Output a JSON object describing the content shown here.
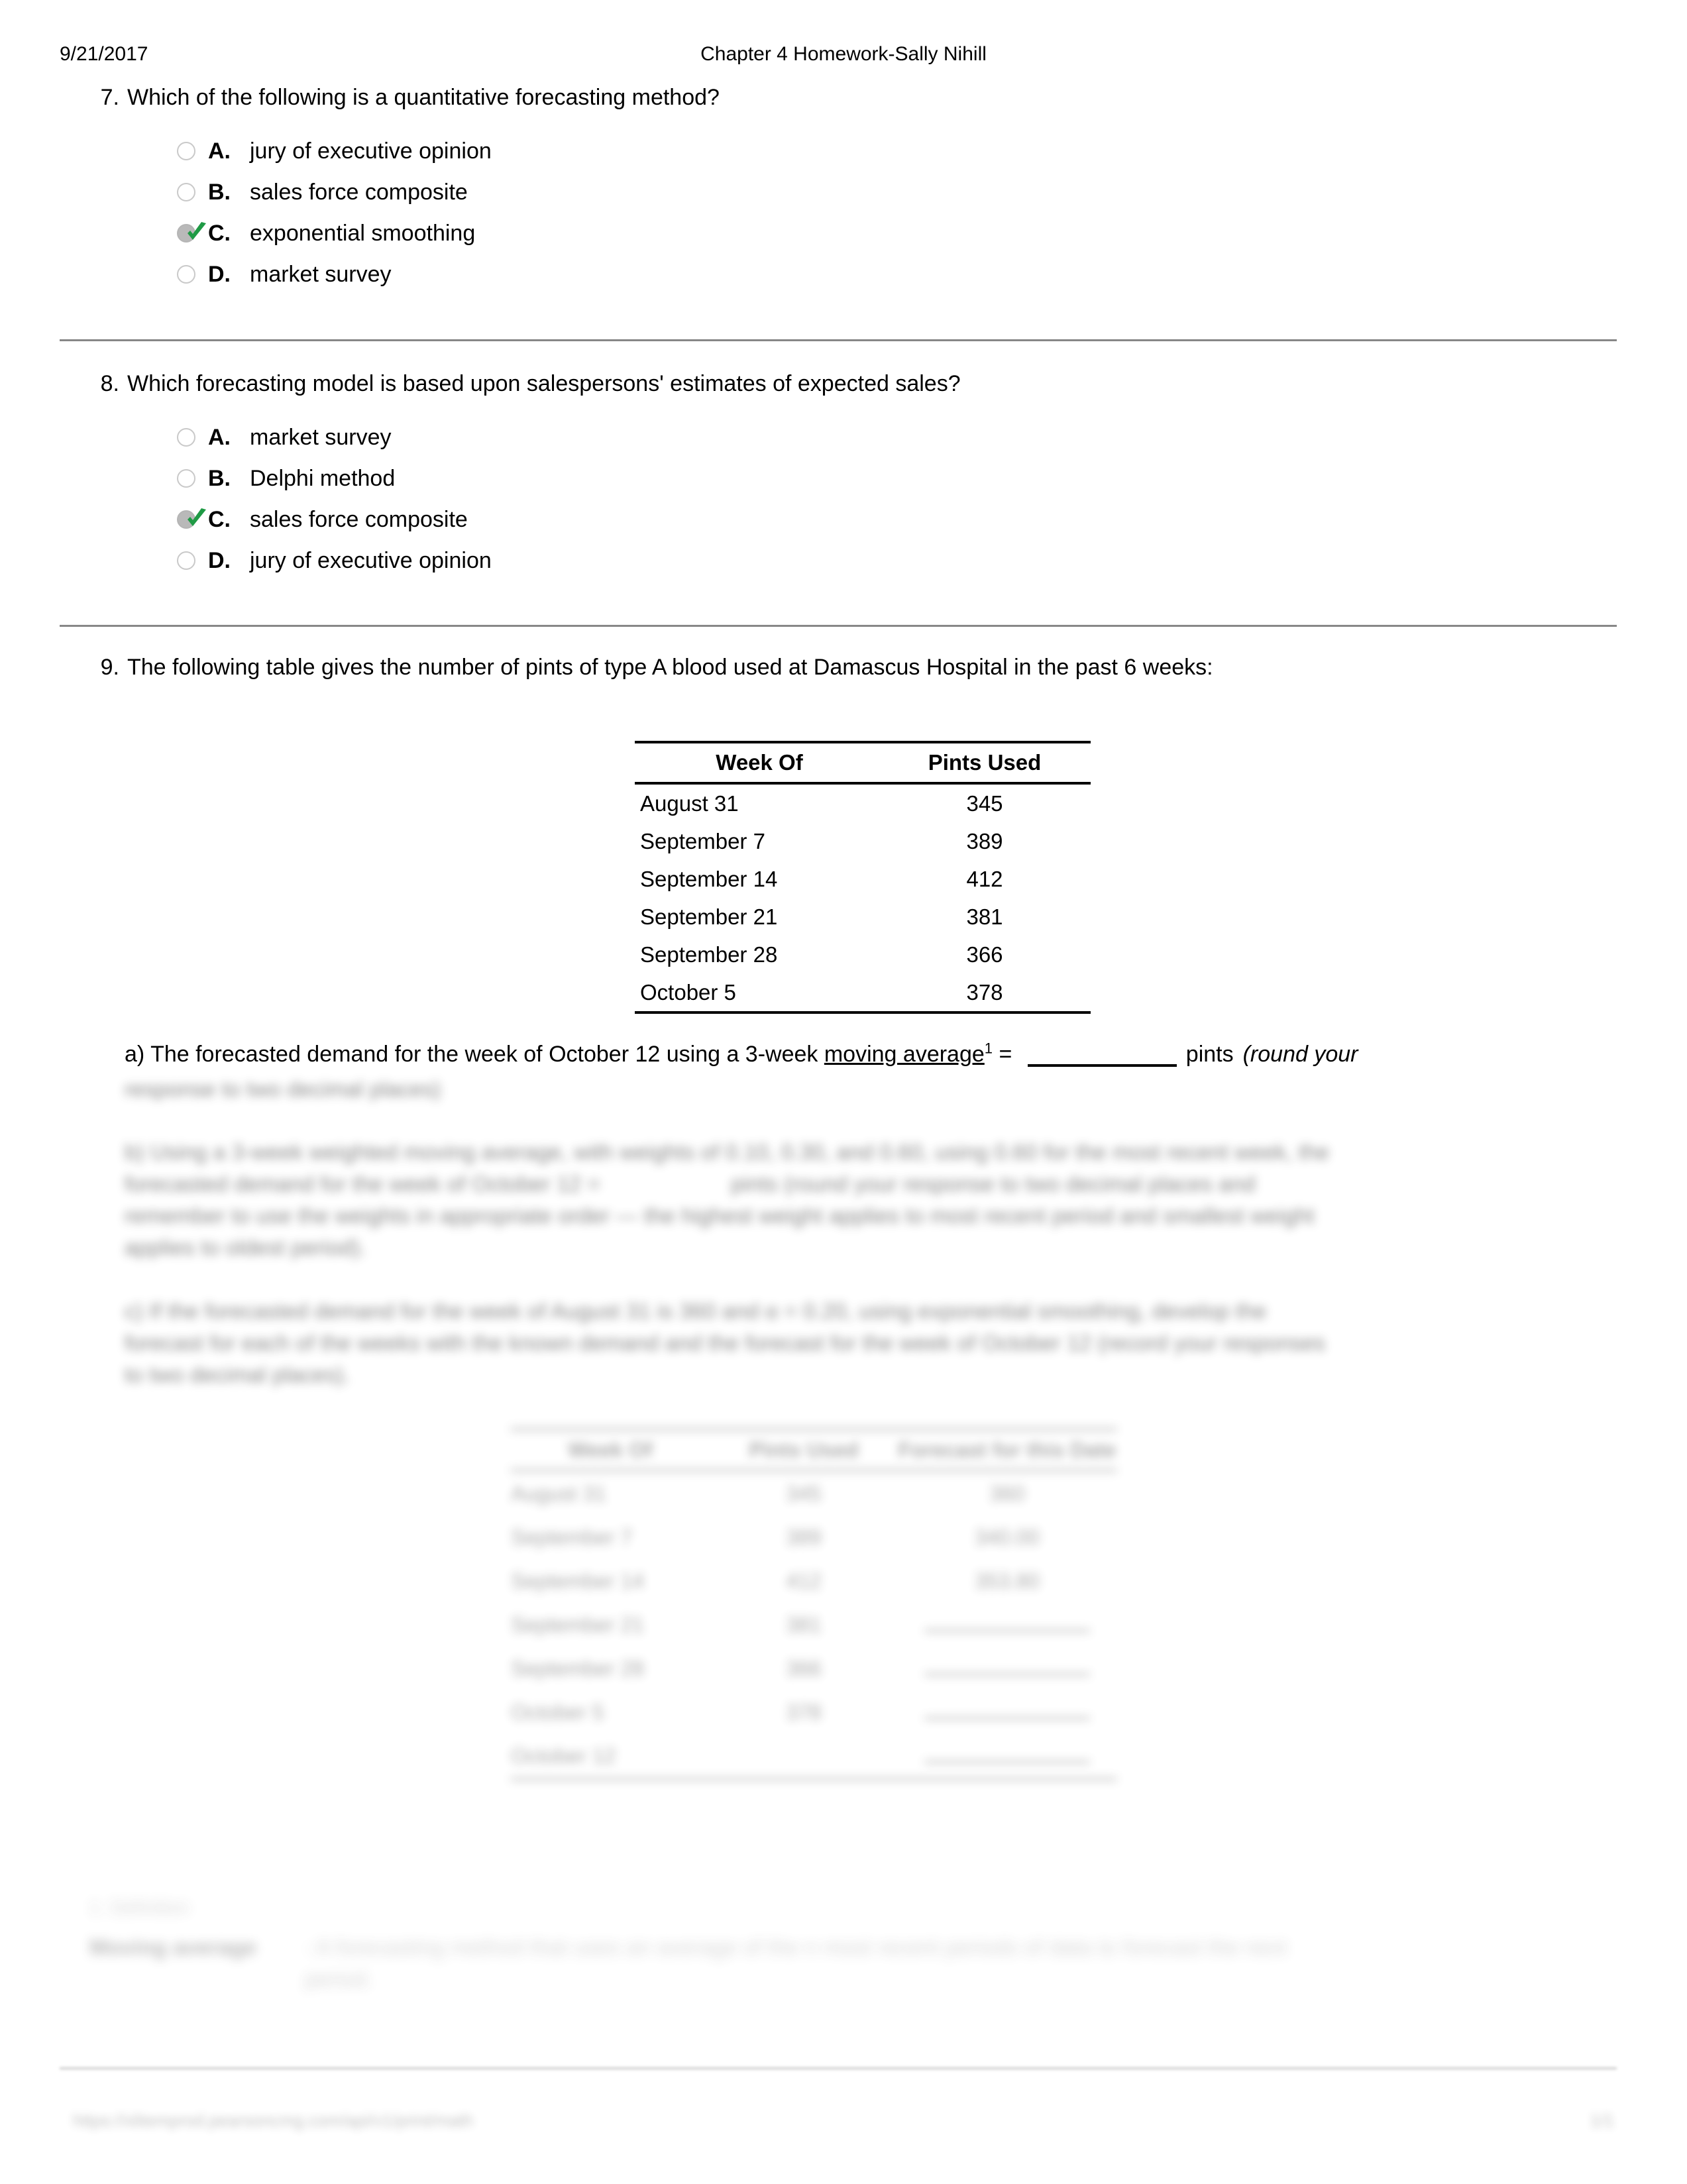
{
  "header": {
    "date": "9/21/2017",
    "title": "Chapter 4 Homework-Sally Nihill"
  },
  "questions": [
    {
      "number": "7.",
      "text": "Which of the following is a quantitative forecasting method?",
      "options": [
        {
          "letter": "A.",
          "label": "jury of executive opinion",
          "selected": false
        },
        {
          "letter": "B.",
          "label": "sales force composite",
          "selected": false
        },
        {
          "letter": "C.",
          "label": "exponential smoothing",
          "selected": true
        },
        {
          "letter": "D.",
          "label": "market survey",
          "selected": false
        }
      ]
    },
    {
      "number": "8.",
      "text": "Which forecasting model is based upon salespersons' estimates of expected sales?",
      "options": [
        {
          "letter": "A.",
          "label": "market survey",
          "selected": false
        },
        {
          "letter": "B.",
          "label": "Delphi method",
          "selected": false
        },
        {
          "letter": "C.",
          "label": "sales force composite",
          "selected": true
        },
        {
          "letter": "D.",
          "label": "jury of executive opinion",
          "selected": false
        }
      ]
    },
    {
      "number": "9.",
      "text": "The following table gives the number of pints of type A blood used at Damascus Hospital in the past 6 weeks:",
      "options": []
    }
  ],
  "blood_table": {
    "headers": [
      "Week Of",
      "Pints Used"
    ],
    "rows": [
      [
        "August 31",
        "345"
      ],
      [
        "September 7",
        "389"
      ],
      [
        "September 14",
        "412"
      ],
      [
        "September 21",
        "381"
      ],
      [
        "September 28",
        "366"
      ],
      [
        "October 5",
        "378"
      ]
    ]
  },
  "part_a": {
    "prefix": "a) The forecasted demand for the week of October 12 using a 3-week ",
    "underlined_term": "moving average",
    "superscript": "1",
    "equals": " = ",
    "units": "pints",
    "instruction": "(round your"
  },
  "obscured": {
    "part_a_cont": "response to two decimal places)",
    "part_b": "b) Using a 3-week weighted moving average, with weights of 0.10, 0.30, and 0.60, using 0.60 for the most recent week, the\nforecasted demand for the week of October 12 =                     pints (round your response to two decimal places and\nremember to use the weights in appropriate order — the highest weight applies to most recent period and smallest weight\napplies to oldest period).",
    "part_c": "c) If the forecasted demand for the week of August 31 is 360 and α = 0.20, using exponential smoothing, develop the\nforecast for each of the weeks with the known demand and the forecast for the week of October 12 (record your responses\nto two decimal places).",
    "blur_table": {
      "headers": [
        "Week Of",
        "Pints Used",
        "Forecast for this Date"
      ],
      "rows": [
        [
          "August 31",
          "345",
          "360"
        ],
        [
          "September 7",
          "389",
          "340.00"
        ],
        [
          "September 14",
          "412",
          "353.80"
        ],
        [
          "September 21",
          "381",
          "__________"
        ],
        [
          "September 28",
          "366",
          "__________"
        ],
        [
          "October 5",
          "378",
          "__________"
        ],
        [
          "October 12",
          "",
          "__________"
        ]
      ]
    },
    "footnote_head": "1. Definition",
    "footnote_term": "Moving average",
    "footnote_text": ": A forecasting method that uses an average of the n most recent periods of data to forecast the next\nperiod.",
    "footer_left": "https://xlitemprod.pearsoncmg.com/api/v1/print/math",
    "footer_right": "1/1"
  },
  "icons": {
    "radio_unselected": "radio-unselected-icon",
    "radio_selected": "radio-selected-icon",
    "check": "green-check-icon"
  },
  "colors": {
    "check_green": "#1f9a45",
    "radio_border": "#c9c9c9",
    "radio_fill": "#b9b9b9",
    "divider": "#878787",
    "text": "#000000"
  }
}
